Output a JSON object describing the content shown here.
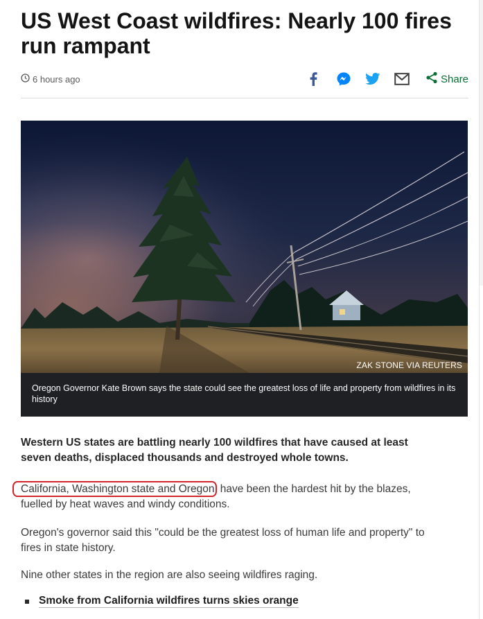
{
  "article": {
    "headline": "US West Coast wildfires: Nearly 100 fires run rampant",
    "timestamp": "6 hours ago"
  },
  "share": {
    "icons": [
      "facebook-icon",
      "messenger-icon",
      "twitter-icon",
      "email-icon",
      "share-icon"
    ],
    "share_label": "Share",
    "brand_colors": {
      "facebook": "#3b5998",
      "messenger": "#0084ff",
      "twitter": "#1da1f2",
      "email": "#404040",
      "share": "#0a6e35"
    }
  },
  "figure": {
    "credit": "ZAK STONE VIA REUTERS",
    "caption": "Oregon Governor Kate Brown says the state could see the greatest loss of life and property from wildfires in its history"
  },
  "body": {
    "lede": "Western US states are battling nearly 100 wildfires that have caused at least seven deaths, displaced thousands and destroyed whole towns.",
    "p1_highlight": "California, Washington state and Oregon",
    "p1_rest": " have been the hardest hit by the blazes, fuelled by heat waves and windy conditions.",
    "p2": "Oregon's governor said this \"could be the greatest loss of human life and property\" to fires in state history.",
    "p3": "Nine other states in the region are also seeing wildfires raging."
  },
  "related": {
    "links": [
      "Smoke from California wildfires turns skies orange"
    ]
  },
  "colors": {
    "highlight_border": "#d2232a",
    "caption_bg": "#1f2024"
  }
}
